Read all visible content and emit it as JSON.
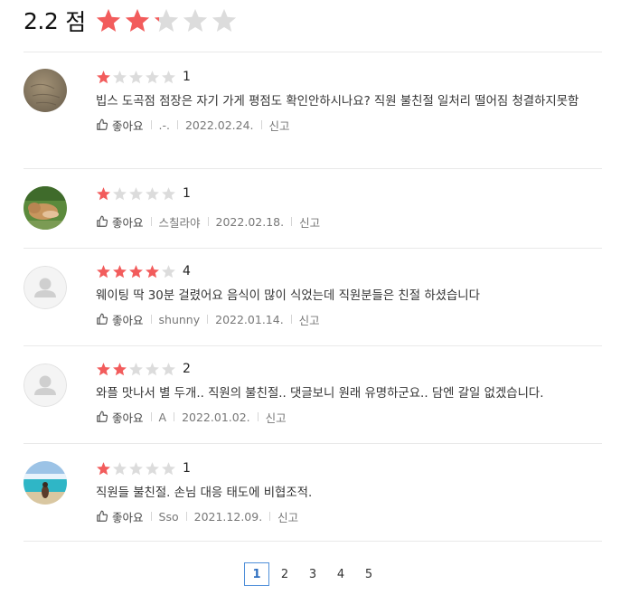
{
  "header": {
    "score": "2.2",
    "unit": "점",
    "rating": 2.2
  },
  "colors": {
    "star_on": "#f25c5c",
    "star_off": "#dcdcdc",
    "active_page": "#4f8fd9"
  },
  "reviews": [
    {
      "avatar": "photo-stone",
      "rating": 1,
      "rating_label": "1",
      "text": "빕스 도곡점 점장은 자기 가게 평점도 확인안하시나요? 직원 불친절 일처리 떨어짐 청결하지못함",
      "like_label": "좋아요",
      "author": ".-.",
      "date": "2022.02.24.",
      "report_label": "신고"
    },
    {
      "avatar": "photo-dog",
      "rating": 1,
      "rating_label": "1",
      "text": "",
      "like_label": "좋아요",
      "author": "스칠라야",
      "date": "2022.02.18.",
      "report_label": "신고"
    },
    {
      "avatar": "default-user",
      "rating": 4,
      "rating_label": "4",
      "text": "웨이팅 딱 30분 걸렸어요 음식이 많이 식었는데 직원분들은 친절 하셨습니다",
      "like_label": "좋아요",
      "author": "shunny",
      "date": "2022.01.14.",
      "report_label": "신고"
    },
    {
      "avatar": "default-user",
      "rating": 2,
      "rating_label": "2",
      "text": "와플 맛나서 별 두개.. 직원의 불친절.. 댓글보니 원래 유명하군요.. 담엔 갈일 없겠습니다.",
      "like_label": "좋아요",
      "author": "A",
      "date": "2022.01.02.",
      "report_label": "신고"
    },
    {
      "avatar": "photo-beach",
      "rating": 1,
      "rating_label": "1",
      "text": "직원들 불친절. 손님 대응 태도에 비협조적.",
      "like_label": "좋아요",
      "author": "Sso",
      "date": "2021.12.09.",
      "report_label": "신고"
    }
  ],
  "pagination": {
    "pages": [
      "1",
      "2",
      "3",
      "4",
      "5"
    ],
    "current": "1"
  }
}
